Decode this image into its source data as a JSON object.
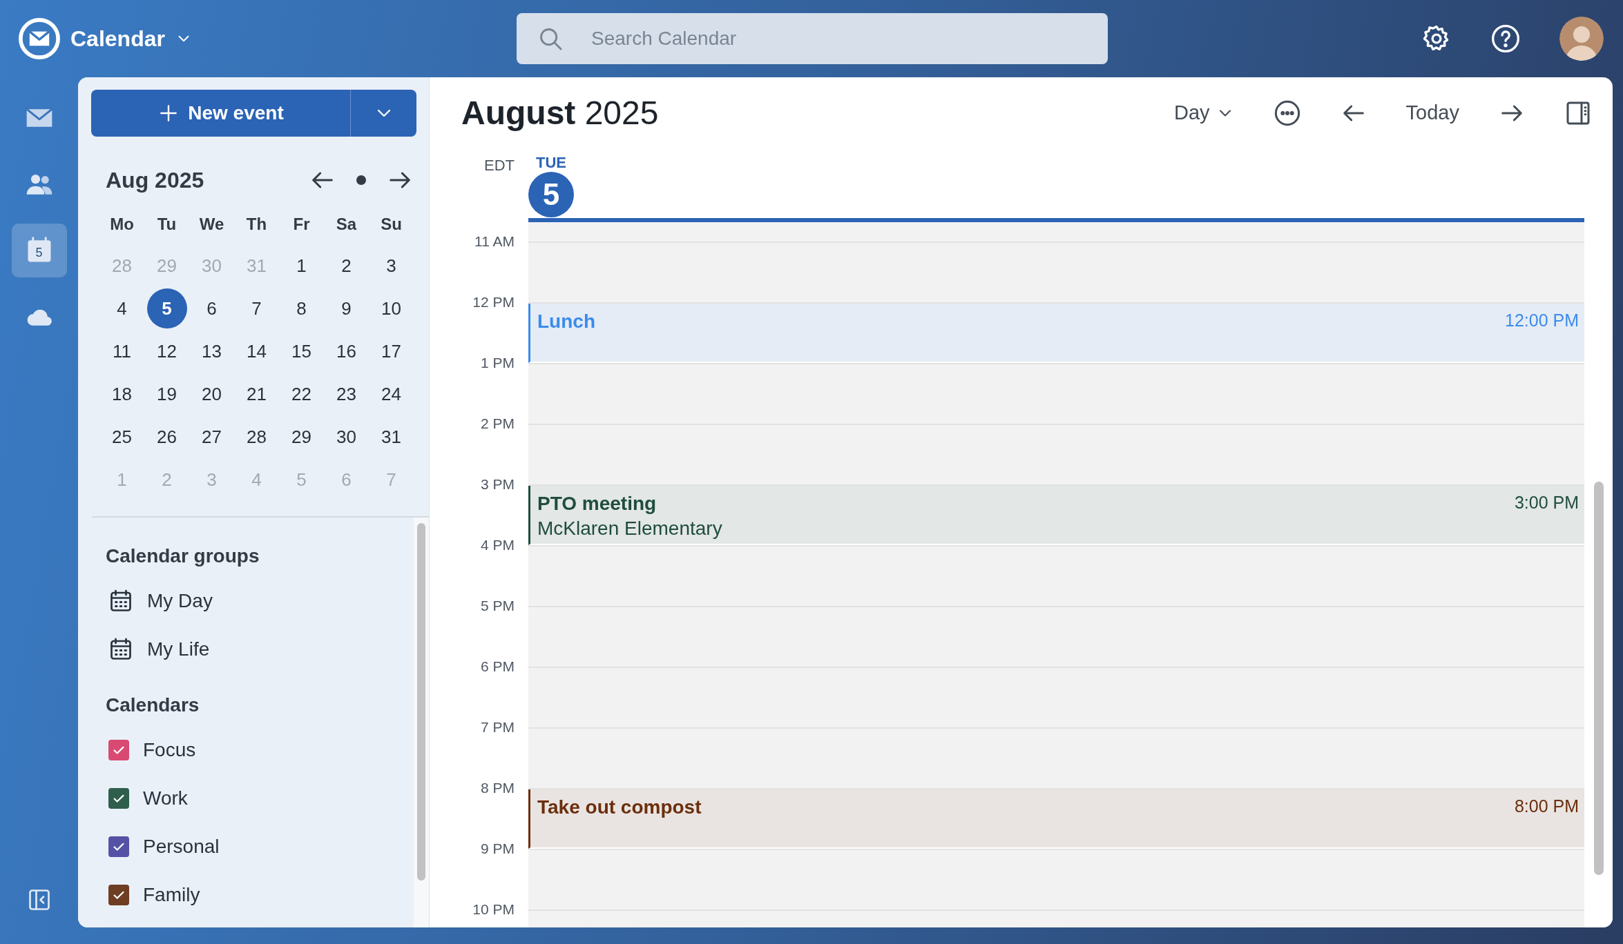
{
  "app": {
    "title": "Calendar"
  },
  "search": {
    "placeholder": "Search Calendar"
  },
  "rail": [
    {
      "kind": "mail",
      "selected": false
    },
    {
      "kind": "people",
      "selected": false
    },
    {
      "kind": "calendar",
      "selected": true,
      "badge": "5"
    },
    {
      "kind": "cloud",
      "selected": false
    }
  ],
  "new_event": {
    "label": "New event"
  },
  "mini_calendar": {
    "title": "Aug 2025",
    "weekdays": [
      "Mo",
      "Tu",
      "We",
      "Th",
      "Fr",
      "Sa",
      "Su"
    ],
    "weeks": [
      [
        {
          "day": "28",
          "outside": true,
          "selected": false
        },
        {
          "day": "29",
          "outside": true,
          "selected": false
        },
        {
          "day": "30",
          "outside": true,
          "selected": false
        },
        {
          "day": "31",
          "outside": true,
          "selected": false
        },
        {
          "day": "1",
          "outside": false,
          "selected": false
        },
        {
          "day": "2",
          "outside": false,
          "selected": false
        },
        {
          "day": "3",
          "outside": false,
          "selected": false
        }
      ],
      [
        {
          "day": "4",
          "outside": false,
          "selected": false
        },
        {
          "day": "5",
          "outside": false,
          "selected": true
        },
        {
          "day": "6",
          "outside": false,
          "selected": false
        },
        {
          "day": "7",
          "outside": false,
          "selected": false
        },
        {
          "day": "8",
          "outside": false,
          "selected": false
        },
        {
          "day": "9",
          "outside": false,
          "selected": false
        },
        {
          "day": "10",
          "outside": false,
          "selected": false
        }
      ],
      [
        {
          "day": "11",
          "outside": false,
          "selected": false
        },
        {
          "day": "12",
          "outside": false,
          "selected": false
        },
        {
          "day": "13",
          "outside": false,
          "selected": false
        },
        {
          "day": "14",
          "outside": false,
          "selected": false
        },
        {
          "day": "15",
          "outside": false,
          "selected": false
        },
        {
          "day": "16",
          "outside": false,
          "selected": false
        },
        {
          "day": "17",
          "outside": false,
          "selected": false
        }
      ],
      [
        {
          "day": "18",
          "outside": false,
          "selected": false
        },
        {
          "day": "19",
          "outside": false,
          "selected": false
        },
        {
          "day": "20",
          "outside": false,
          "selected": false
        },
        {
          "day": "21",
          "outside": false,
          "selected": false
        },
        {
          "day": "22",
          "outside": false,
          "selected": false
        },
        {
          "day": "23",
          "outside": false,
          "selected": false
        },
        {
          "day": "24",
          "outside": false,
          "selected": false
        }
      ],
      [
        {
          "day": "25",
          "outside": false,
          "selected": false
        },
        {
          "day": "26",
          "outside": false,
          "selected": false
        },
        {
          "day": "27",
          "outside": false,
          "selected": false
        },
        {
          "day": "28",
          "outside": false,
          "selected": false
        },
        {
          "day": "29",
          "outside": false,
          "selected": false
        },
        {
          "day": "30",
          "outside": false,
          "selected": false
        },
        {
          "day": "31",
          "outside": false,
          "selected": false
        }
      ],
      [
        {
          "day": "1",
          "outside": true,
          "selected": false
        },
        {
          "day": "2",
          "outside": true,
          "selected": false
        },
        {
          "day": "3",
          "outside": true,
          "selected": false
        },
        {
          "day": "4",
          "outside": true,
          "selected": false
        },
        {
          "day": "5",
          "outside": true,
          "selected": false
        },
        {
          "day": "6",
          "outside": true,
          "selected": false
        },
        {
          "day": "7",
          "outside": true,
          "selected": false
        }
      ]
    ]
  },
  "calendar_groups": {
    "title": "Calendar groups",
    "items": [
      "My Day",
      "My Life"
    ]
  },
  "calendars": {
    "title": "Calendars",
    "items": [
      {
        "name": "Focus",
        "checked": true,
        "color": "#d84a72"
      },
      {
        "name": "Work",
        "checked": true,
        "color": "#2f5e4c"
      },
      {
        "name": "Personal",
        "checked": true,
        "color": "#5552a6"
      },
      {
        "name": "Family",
        "checked": true,
        "color": "#6e3d22"
      }
    ]
  },
  "header": {
    "month": "August",
    "year": "2025",
    "view": "Day",
    "today": "Today"
  },
  "day": {
    "timezone": "EDT",
    "weekday": "TUE",
    "date": "5"
  },
  "hours": [
    {
      "label": "11 AM"
    },
    {
      "label": "12 PM",
      "events": [
        {
          "title": "Lunch",
          "time": "12:00 PM",
          "color": "#3b8beb"
        }
      ]
    },
    {
      "label": "1 PM"
    },
    {
      "label": "2 PM"
    },
    {
      "label": "3 PM",
      "events": [
        {
          "title": "PTO meeting",
          "location": "McKlaren Elementary",
          "time": "3:00 PM",
          "color": "#1f4d3c"
        }
      ]
    },
    {
      "label": "4 PM"
    },
    {
      "label": "5 PM"
    },
    {
      "label": "6 PM"
    },
    {
      "label": "7 PM"
    },
    {
      "label": "8 PM",
      "events": [
        {
          "title": "Take out compost",
          "time": "8:00 PM",
          "color": "#6b2e0c"
        }
      ]
    },
    {
      "label": "9 PM"
    },
    {
      "label": "10 PM"
    }
  ]
}
